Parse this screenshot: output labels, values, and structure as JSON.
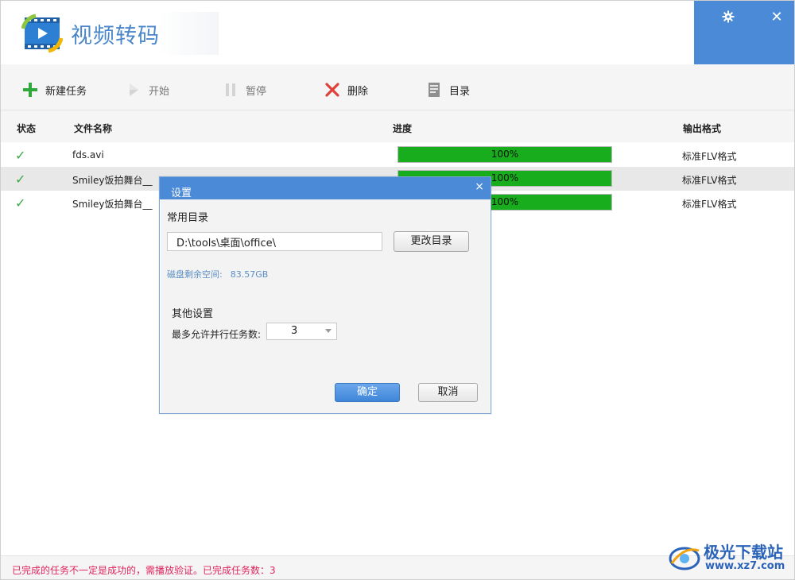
{
  "app": {
    "title": "视频转码",
    "brand_color": "#4a8ad6"
  },
  "titlebar": {
    "settings_icon": "gear-icon",
    "close_icon": "close-icon",
    "close_glyph": "✕"
  },
  "toolbar": {
    "new_task": "新建任务",
    "start": "开始",
    "pause": "暂停",
    "delete": "删除",
    "directory": "目录"
  },
  "table": {
    "headers": {
      "status": "状态",
      "name": "文件名称",
      "progress": "进度",
      "format": "输出格式"
    },
    "rows": [
      {
        "status_glyph": "✓",
        "name": "fds.avi",
        "progress": 1.0,
        "progress_text": "100%",
        "format": "标准FLV格式"
      },
      {
        "status_glyph": "✓",
        "name": "Smiley饭拍舞台__",
        "progress": 1.0,
        "progress_text": "100%",
        "format": "标准FLV格式"
      },
      {
        "status_glyph": "✓",
        "name": "Smiley饭拍舞台__",
        "progress": 1.0,
        "progress_text": "100%",
        "format": "标准FLV格式"
      }
    ],
    "progress_color": "#18ad1d",
    "check_color": "#3aa845"
  },
  "statusbar": {
    "text": "已完成的任务不一定是成功的，需播放验证。已完成任务数：3",
    "color": "#e0245e"
  },
  "watermark": {
    "name": "极光下载站",
    "url": "www.xz7.com"
  },
  "dialog": {
    "title": "设置",
    "close_glyph": "×",
    "section_common": "常用目录",
    "path_value": "D:\\tools\\桌面\\office\\",
    "change_dir_button": "更改目录",
    "disk_label": "磁盘剩余空间:",
    "disk_value": "83.57GB",
    "section_other": "其他设置",
    "parallel_label": "最多允许并行任务数:",
    "parallel_value": "3",
    "ok_button": "确定",
    "cancel_button": "取消"
  }
}
